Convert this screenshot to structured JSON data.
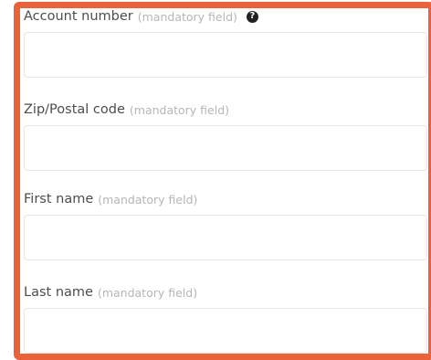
{
  "form": {
    "fields": [
      {
        "label": "Account number",
        "hint": "(mandatory field)",
        "value": "",
        "help_icon": "question-circle-icon"
      },
      {
        "label": "Zip/Postal code",
        "hint": "(mandatory field)",
        "value": ""
      },
      {
        "label": "First name",
        "hint": "(mandatory field)",
        "value": ""
      },
      {
        "label": "Last name",
        "hint": "(mandatory field)",
        "value": ""
      }
    ]
  },
  "colors": {
    "frame_border": "#e9623a",
    "label_text": "#4d4d4d",
    "hint_text": "#b6b6b6",
    "input_border": "#e6e6e6"
  }
}
